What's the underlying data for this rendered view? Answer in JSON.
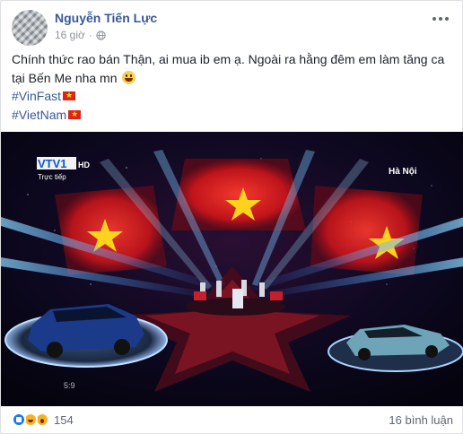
{
  "post": {
    "author": "Nguyễn Tiến Lực",
    "time": "16 giờ",
    "text_line1": "Chính thức rao bán Thận, ai mua ib em ạ. Ngoài ra hằng đêm em làm tăng ca",
    "text_line2": "tại Bến Me nha mn",
    "hashtags": [
      "#VinFast",
      "#VietNam"
    ],
    "privacy_icon": "globe-icon",
    "menu_icon": "more-icon"
  },
  "media": {
    "broadcaster": "VTV1",
    "hd_label": "HD",
    "live_label": "Trực tiếp",
    "location": "Hà Nội",
    "timestamp_overlay": "5:9"
  },
  "footer": {
    "reaction_count": "154",
    "comment_count": "16 bình luận",
    "reaction_icons": [
      "like-icon",
      "haha-icon",
      "wow-icon"
    ]
  },
  "colors": {
    "author_link": "#385898",
    "flag_red": "#da251d",
    "flag_star": "#ffdd00"
  }
}
